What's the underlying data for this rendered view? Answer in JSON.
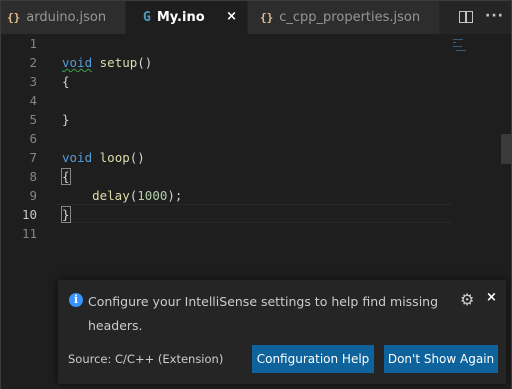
{
  "tabs": [
    {
      "icon": "{}",
      "label": "arduino.json",
      "active": false
    },
    {
      "icon": "G",
      "label": "My.ino",
      "active": true,
      "close": "×"
    },
    {
      "icon": "{}",
      "label": "c_cpp_properties.json",
      "active": false
    }
  ],
  "editor": {
    "line_numbers": [
      "1",
      "2",
      "3",
      "4",
      "5",
      "6",
      "7",
      "8",
      "9",
      "10",
      "11"
    ],
    "current_line": "10",
    "code": {
      "setup_kw": "void",
      "setup_fn": "setup",
      "setup_paren": "()",
      "open1": "{",
      "close1": "}",
      "loop_kw": "void",
      "loop_fn": "loop",
      "loop_paren": "()",
      "open2": "{",
      "delay_fn": "delay",
      "delay_open": "(",
      "delay_num": "1000",
      "delay_close": ");",
      "close2": "}"
    }
  },
  "notification": {
    "message": "Configure your IntelliSense settings to help find missing headers.",
    "source": "Source: C/C++ (Extension)",
    "primary_button": "Configuration Help",
    "secondary_button": "Don't Show Again",
    "close": "×",
    "gear": "⚙",
    "info": "i"
  },
  "colors": {
    "keyword": "#569cd6",
    "function": "#dcdcaa",
    "number": "#b5cea8",
    "button": "#0e639c",
    "info": "#3794ff"
  }
}
